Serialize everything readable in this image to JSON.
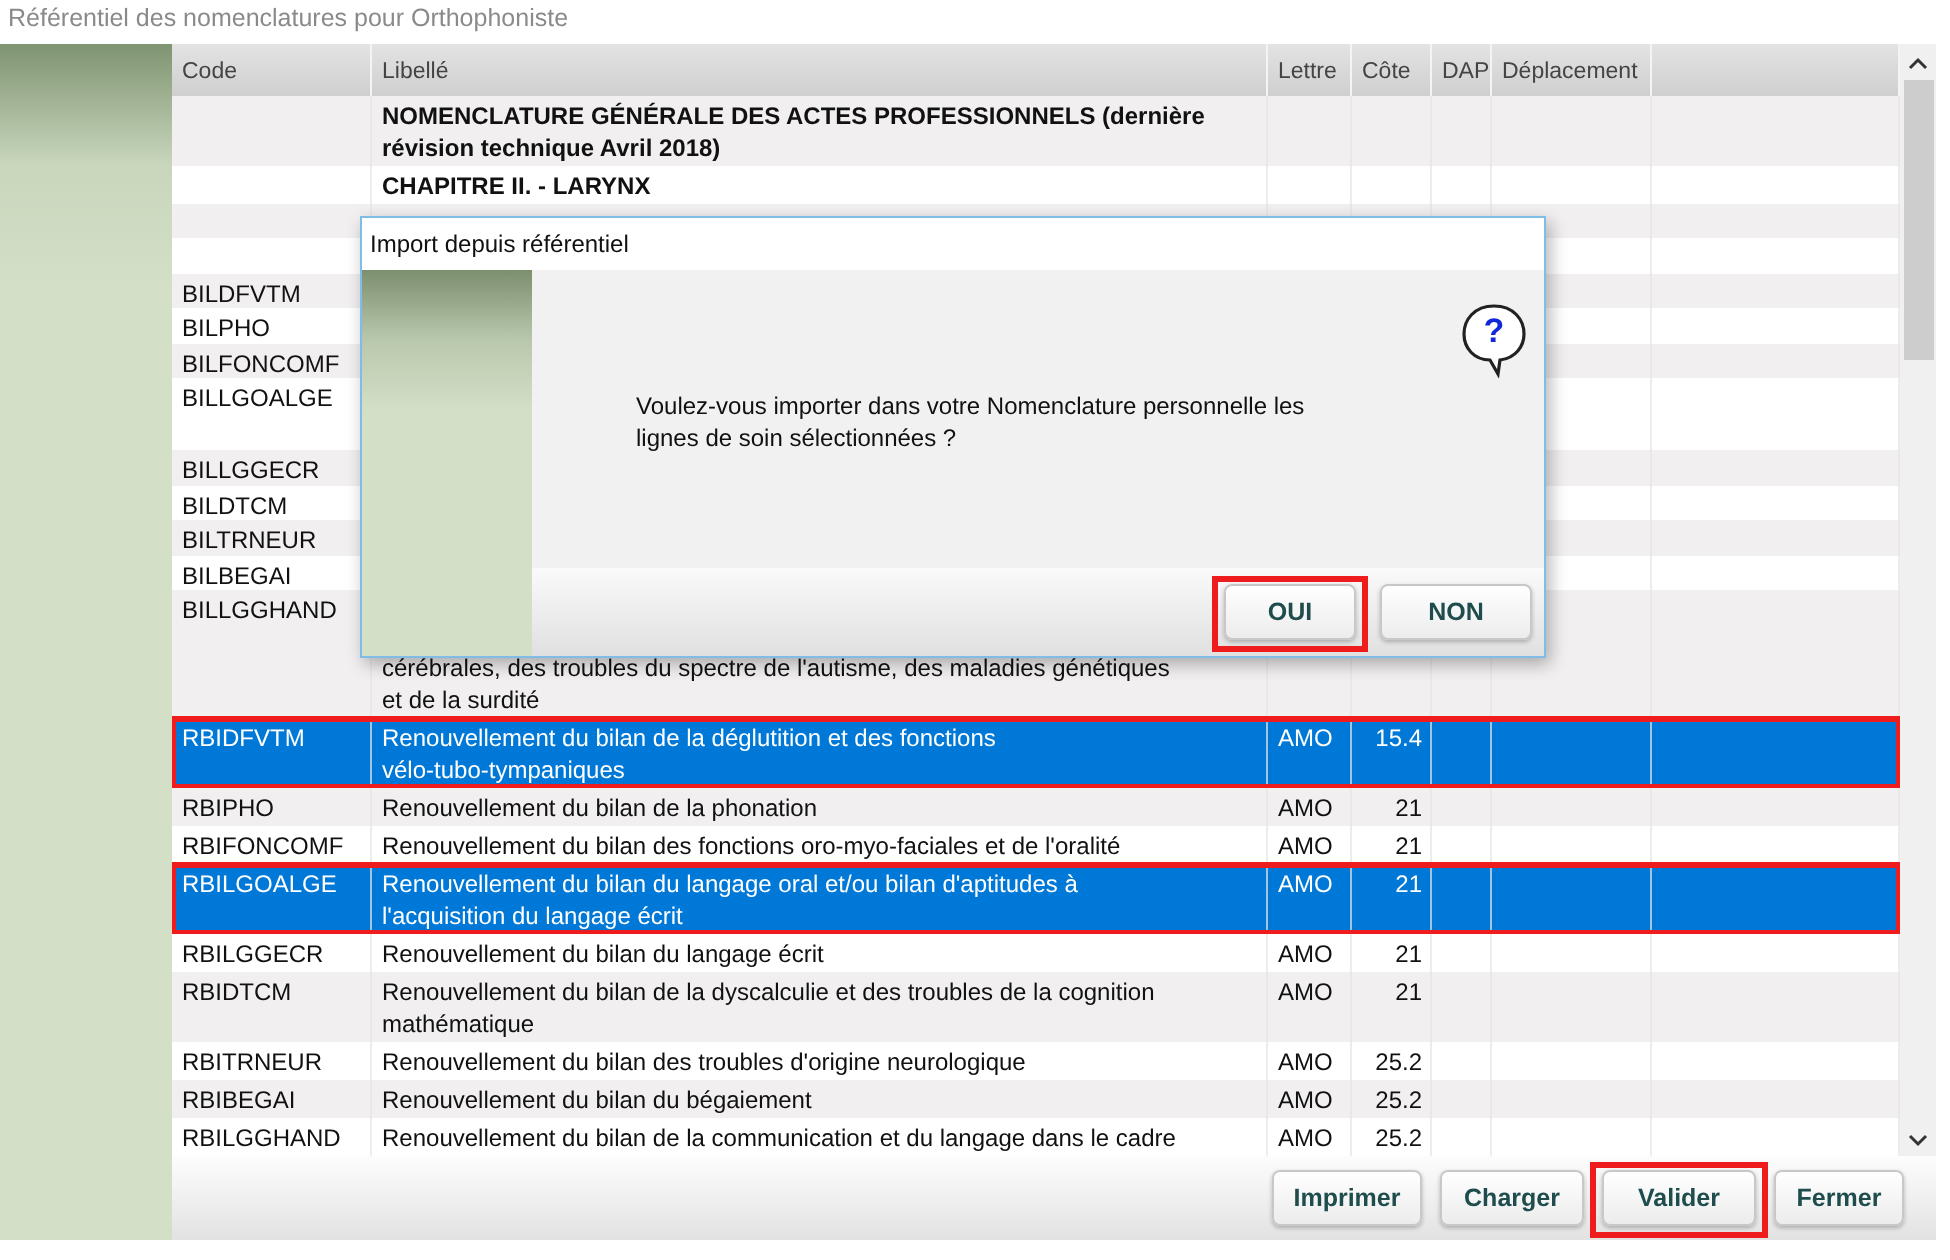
{
  "window": {
    "title": "Référentiel des nomenclatures pour Orthophoniste"
  },
  "table": {
    "columns": [
      "Code",
      "Libellé",
      "Lettre",
      "Côte",
      "DAP",
      "Déplacement"
    ],
    "rows": [
      {
        "kind": "heading",
        "code": "",
        "libelle": "NOMENCLATURE GÉNÉRALE DES ACTES PROFESSIONNELS  (dernière\nrévision technique Avril 2018)",
        "selected": false,
        "annotated": false
      },
      {
        "kind": "heading",
        "code": "",
        "libelle": "CHAPITRE II. - LARYNX",
        "selected": false,
        "annotated": false
      },
      {
        "kind": "covered",
        "code": "",
        "selected": false,
        "annotated": false
      },
      {
        "kind": "covered",
        "code": "",
        "selected": false,
        "annotated": false
      },
      {
        "kind": "covered",
        "code": "BILDFVTM",
        "selected": false,
        "annotated": false
      },
      {
        "kind": "covered",
        "code": "BILPHO",
        "selected": false,
        "annotated": false
      },
      {
        "kind": "covered",
        "code": "BILFONCOMF",
        "selected": false,
        "annotated": false
      },
      {
        "kind": "covered-tall",
        "code": "BILLGOALGE",
        "selected": false,
        "annotated": false
      },
      {
        "kind": "covered",
        "code": "BILLGGECR",
        "selected": false,
        "annotated": false
      },
      {
        "kind": "covered",
        "code": "BILDTCM",
        "selected": false,
        "annotated": false
      },
      {
        "kind": "covered",
        "code": "BILTRNEUR",
        "selected": false,
        "annotated": false
      },
      {
        "kind": "covered",
        "code": "BILBEGAI",
        "selected": false,
        "annotated": false
      },
      {
        "kind": "tail",
        "code": "BILLGGHAND",
        "libelle": "cérébrales, des troubles du spectre de l'autisme, des maladies génétiques\net de la surdité",
        "selected": false,
        "annotated": false
      },
      {
        "kind": "act",
        "code": "RBIDFVTM",
        "libelle": "Renouvellement du bilan de la déglutition et des fonctions\nvélo-tubo-tympaniques",
        "lettre": "AMO",
        "cote": "15.4",
        "selected": true,
        "annotated": true
      },
      {
        "kind": "act",
        "code": "RBIPHO",
        "libelle": "Renouvellement du bilan de la phonation",
        "lettre": "AMO",
        "cote": "21",
        "selected": false,
        "annotated": false
      },
      {
        "kind": "act",
        "code": "RBIFONCOMF",
        "libelle": "Renouvellement du bilan des fonctions oro-myo-faciales et de l'oralité",
        "lettre": "AMO",
        "cote": "21",
        "selected": false,
        "annotated": false
      },
      {
        "kind": "act",
        "code": "RBILGOALGE",
        "libelle": "Renouvellement du bilan du langage oral et/ou bilan d'aptitudes à\nl'acquisition du langage écrit",
        "lettre": "AMO",
        "cote": "21",
        "selected": true,
        "annotated": true
      },
      {
        "kind": "act",
        "code": "RBILGGECR",
        "libelle": "Renouvellement du bilan du langage écrit",
        "lettre": "AMO",
        "cote": "21",
        "selected": false,
        "annotated": false
      },
      {
        "kind": "act",
        "code": "RBIDTCM",
        "libelle": "Renouvellement du bilan de la dyscalculie et des troubles de la cognition\nmathématique",
        "lettre": "AMO",
        "cote": "21",
        "selected": false,
        "annotated": false
      },
      {
        "kind": "act",
        "code": "RBITRNEUR",
        "libelle": "Renouvellement du bilan des troubles d'origine neurologique",
        "lettre": "AMO",
        "cote": "25.2",
        "selected": false,
        "annotated": false
      },
      {
        "kind": "act",
        "code": "RBIBEGAI",
        "libelle": "Renouvellement du bilan du bégaiement",
        "lettre": "AMO",
        "cote": "25.2",
        "selected": false,
        "annotated": false
      },
      {
        "kind": "act",
        "code": "RBILGGHAND",
        "libelle": "Renouvellement du bilan de la communication et du langage dans le cadre",
        "lettre": "AMO",
        "cote": "25.2",
        "selected": false,
        "annotated": false
      }
    ]
  },
  "footer_buttons": [
    {
      "label": "Imprimer",
      "annotated": false
    },
    {
      "label": "Charger",
      "annotated": false
    },
    {
      "label": "Valider",
      "annotated": true
    },
    {
      "label": "Fermer",
      "annotated": false
    }
  ],
  "dialog": {
    "title": "Import depuis référentiel",
    "icon_glyph": "?",
    "message": "Voulez-vous importer dans votre Nomenclature personnelle les\nlignes de soin sélectionnées ?",
    "buttons": [
      {
        "label": "OUI",
        "annotated": true
      },
      {
        "label": "NON",
        "annotated": false
      }
    ]
  }
}
